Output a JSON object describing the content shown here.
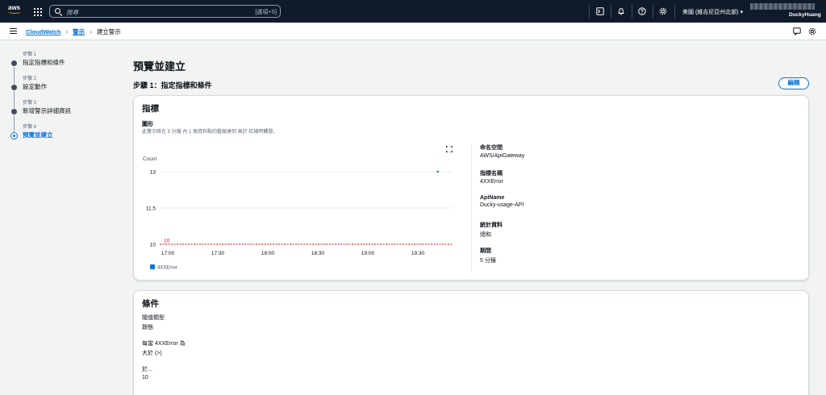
{
  "topnav": {
    "logo_text": "aws",
    "search_placeholder": "搜尋",
    "search_shortcut": "[選項+S]",
    "region": "美國 (維吉尼亞州北部)",
    "user": "DuckyHuang",
    "icons": [
      "grid-icon",
      "search-icon",
      "cloudshell-icon",
      "bell-icon",
      "help-icon",
      "gear-icon"
    ],
    "bg_color": "#0f1b2a",
    "accent_color": "#ff9900"
  },
  "breadcrumb": {
    "items": [
      "CloudWatch",
      "警示",
      "建立警示"
    ]
  },
  "steps": [
    {
      "num": "步驟 1",
      "label": "指定指標和條件"
    },
    {
      "num": "步驟 2",
      "label": "設定動作"
    },
    {
      "num": "步驟 3",
      "label": "新增警示詳細資訊"
    },
    {
      "num": "步驟 4",
      "label": "預覽並建立"
    }
  ],
  "active_step": 4,
  "page": {
    "title": "預覽並建立",
    "subtitle": "步驟 1：指定指標和條件",
    "edit_label": "編輯"
  },
  "metric_card": {
    "heading": "指標",
    "graph_title": "圖形",
    "graph_desc": "此警示將在 5 分鐘 內 1 個資料點的藍線達到 高於 紅線時觸發。",
    "details": [
      {
        "key": "命名空間",
        "value": "AWS/ApiGateway"
      },
      {
        "key": "指標名稱",
        "value": "4XXError"
      },
      {
        "key": "ApiName",
        "value": "Ducky-usage-API"
      },
      {
        "key": "統計資料",
        "value": "總和"
      },
      {
        "key": "期間",
        "value": "5 分鐘"
      }
    ]
  },
  "chart_data": {
    "type": "line",
    "ylabel": "Count",
    "yticks": [
      13,
      11.5,
      10
    ],
    "ylim": [
      10,
      13
    ],
    "xticks": [
      "17:00",
      "17:30",
      "18:00",
      "18:30",
      "19:00",
      "19:30"
    ],
    "grid": true,
    "legend_position": "bottom-left",
    "series": [
      {
        "name": "4XXError",
        "color": "#0972d3",
        "points": [
          {
            "x": "19:42",
            "y": 13
          }
        ]
      }
    ],
    "threshold": {
      "value": 10,
      "label": "10",
      "color": "#d91515"
    }
  },
  "conditions_card": {
    "heading": "條件",
    "items": [
      {
        "key": "閾值類型",
        "value": "靜態"
      },
      {
        "key": "每當 4XXError 為",
        "value": "大於 (>)"
      },
      {
        "key": "於...",
        "value": "10"
      }
    ]
  }
}
